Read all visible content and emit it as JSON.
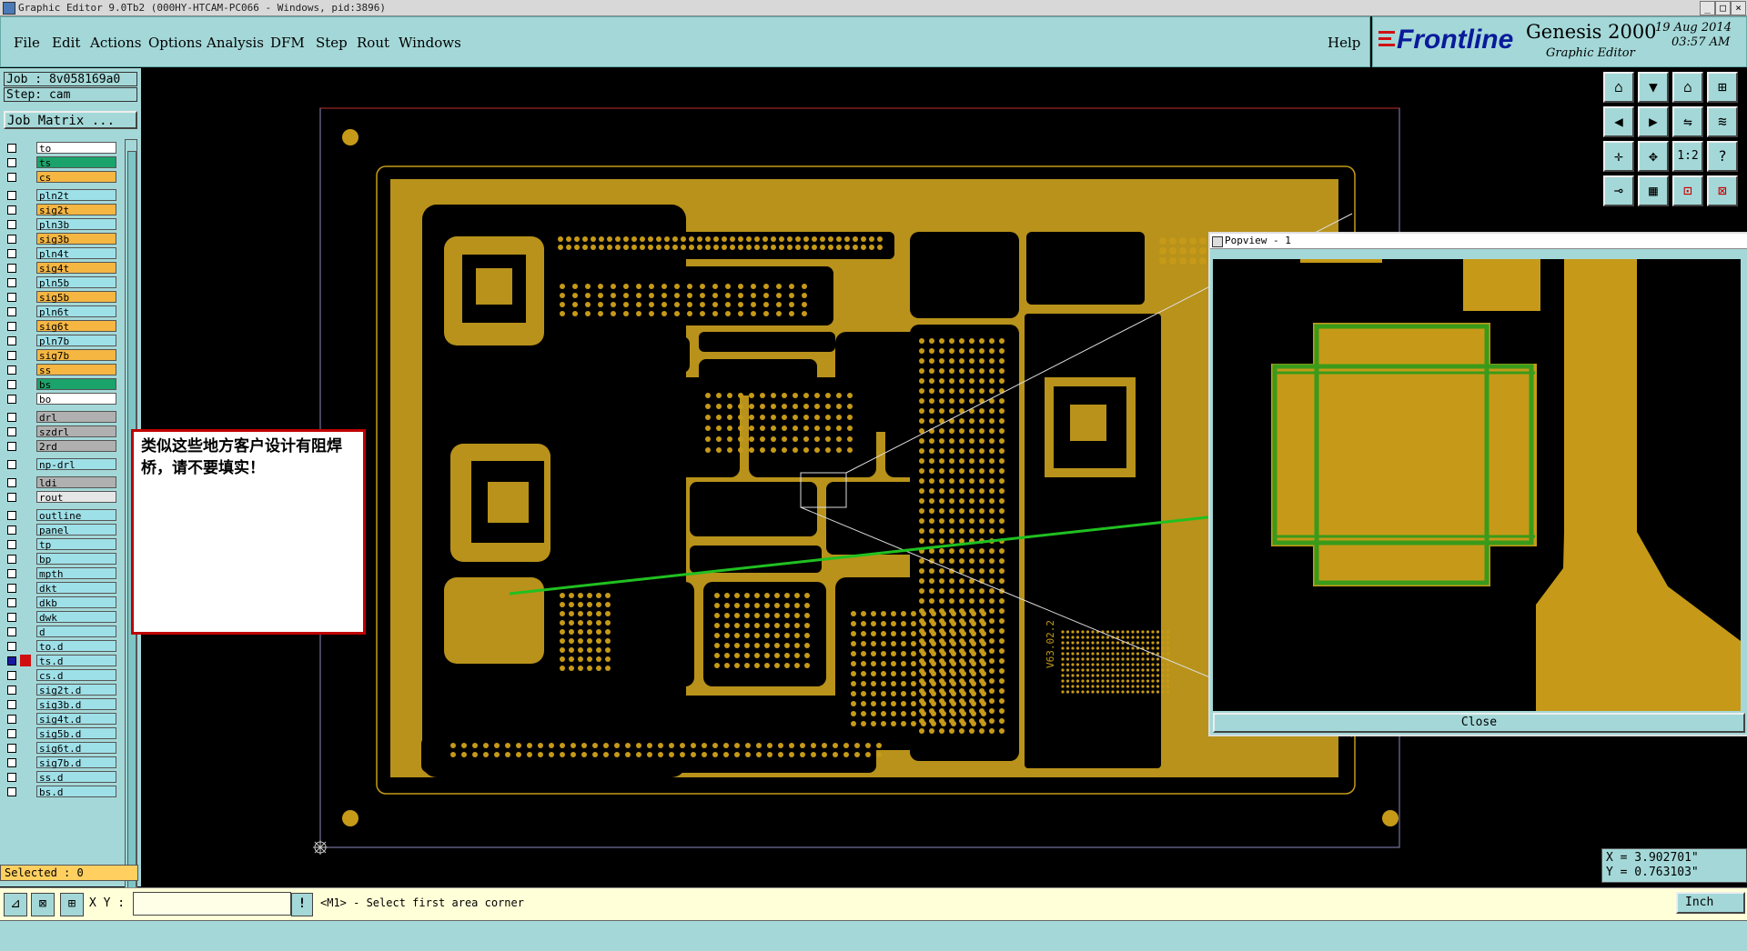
{
  "window": {
    "title": "Graphic Editor 9.0Tb2 (000HY-HTCAM-PC066 - Windows, pid:3896)"
  },
  "menu": {
    "items": [
      "File",
      "Edit",
      "Actions",
      "Options",
      "Analysis",
      "DFM",
      "Step",
      "Rout",
      "Windows"
    ],
    "help": "Help"
  },
  "brand": {
    "logo": "Frontline",
    "product": "Genesis 2000",
    "subtitle": "Graphic Editor",
    "date": "19 Aug 2014",
    "time": "03:57 AM"
  },
  "job": {
    "job_label": "Job : 8v058169a0",
    "step_label": "Step: cam",
    "matrix_button": "Job Matrix ..."
  },
  "layers": [
    {
      "name": "to",
      "color": "#ffffff"
    },
    {
      "name": "ts",
      "color": "#1aa36b"
    },
    {
      "name": "cs",
      "color": "#f5b642"
    },
    {
      "name": "pln2t",
      "color": "#9ee0e8"
    },
    {
      "name": "sig2t",
      "color": "#f5b642"
    },
    {
      "name": "pln3b",
      "color": "#9ee0e8"
    },
    {
      "name": "sig3b",
      "color": "#f5b642"
    },
    {
      "name": "pln4t",
      "color": "#9ee0e8"
    },
    {
      "name": "sig4t",
      "color": "#f5b642"
    },
    {
      "name": "pln5b",
      "color": "#9ee0e8"
    },
    {
      "name": "sig5b",
      "color": "#f5b642"
    },
    {
      "name": "pln6t",
      "color": "#9ee0e8"
    },
    {
      "name": "sig6t",
      "color": "#f5b642"
    },
    {
      "name": "pln7b",
      "color": "#9ee0e8"
    },
    {
      "name": "sig7b",
      "color": "#f5b642"
    },
    {
      "name": "ss",
      "color": "#f5b642"
    },
    {
      "name": "bs",
      "color": "#1aa36b"
    },
    {
      "name": "bo",
      "color": "#ffffff"
    },
    {
      "name": "drl",
      "color": "#b0b0b0"
    },
    {
      "name": "szdrl",
      "color": "#b0b0b0"
    },
    {
      "name": "2rd",
      "color": "#b0b0b0"
    },
    {
      "name": "np-drl",
      "color": "#9ee0e8"
    },
    {
      "name": "ldi",
      "color": "#b0b0b0"
    },
    {
      "name": "rout",
      "color": "#e6e6e6"
    },
    {
      "name": "outline",
      "color": "#9ee0e8"
    },
    {
      "name": "panel",
      "color": "#9ee0e8"
    },
    {
      "name": "tp",
      "color": "#9ee0e8"
    },
    {
      "name": "bp",
      "color": "#9ee0e8"
    },
    {
      "name": "mpth",
      "color": "#9ee0e8"
    },
    {
      "name": "dkt",
      "color": "#9ee0e8"
    },
    {
      "name": "dkb",
      "color": "#9ee0e8"
    },
    {
      "name": "dwk",
      "color": "#9ee0e8"
    },
    {
      "name": "d",
      "color": "#9ee0e8"
    },
    {
      "name": "to.d",
      "color": "#9ee0e8"
    },
    {
      "name": "ts.d",
      "color": "#9ee0e8",
      "active": true
    },
    {
      "name": "cs.d",
      "color": "#9ee0e8"
    },
    {
      "name": "sig2t.d",
      "color": "#9ee0e8"
    },
    {
      "name": "sig3b.d",
      "color": "#9ee0e8"
    },
    {
      "name": "sig4t.d",
      "color": "#9ee0e8"
    },
    {
      "name": "sig5b.d",
      "color": "#9ee0e8"
    },
    {
      "name": "sig6t.d",
      "color": "#9ee0e8"
    },
    {
      "name": "sig7b.d",
      "color": "#9ee0e8"
    },
    {
      "name": "ss.d",
      "color": "#9ee0e8"
    },
    {
      "name": "bs.d",
      "color": "#9ee0e8"
    }
  ],
  "selected": "Selected : 0",
  "annotation": "类似这些地方客户设计有阻焊桥，请不要填实！",
  "popview": {
    "title": "Popview - 1",
    "close": "Close"
  },
  "coords": {
    "x": "X = 3.902701\"",
    "y": "Y = 0.763103\""
  },
  "bottom": {
    "xy_label": "X Y :",
    "xy_value": "",
    "prompt": "<M1> - Select first area corner",
    "units": "Inch"
  },
  "board": {
    "id_text": "V63.02.2"
  },
  "colors": {
    "panel_bg": "#a4d8d8",
    "copper": "#b8921a",
    "popview_copper": "#c69a18",
    "popview_green": "#3a9a1a",
    "arrow": "#20c020"
  }
}
